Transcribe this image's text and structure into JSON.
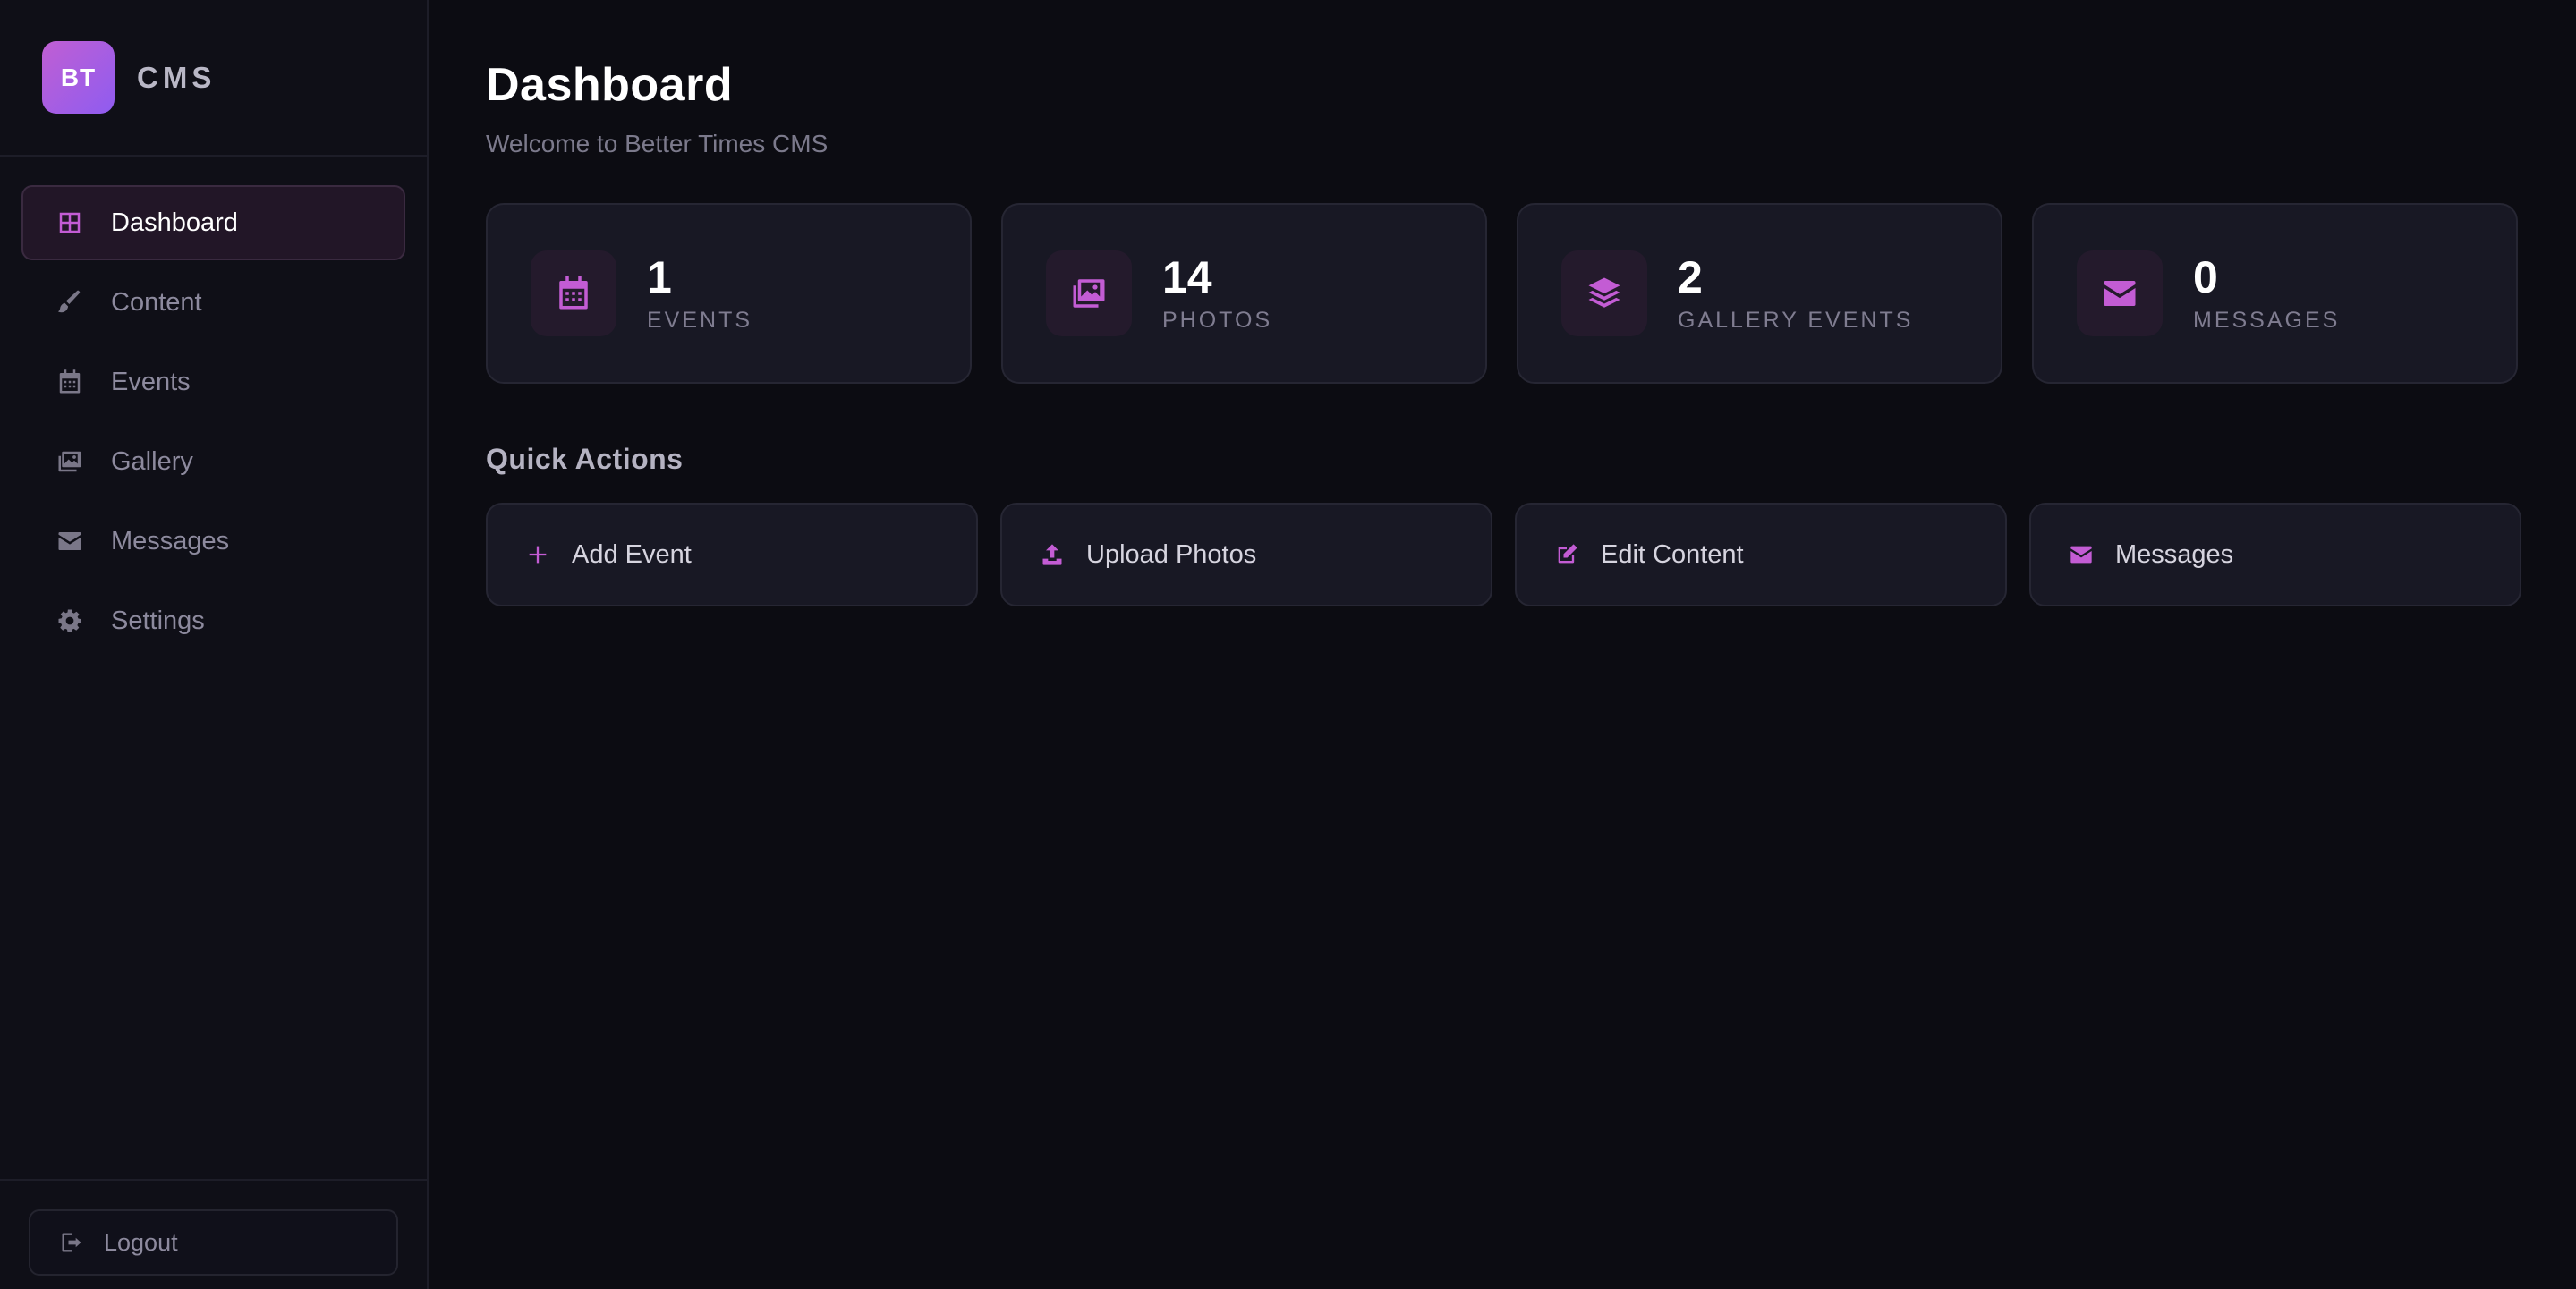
{
  "brand": {
    "logo_text": "BT",
    "name": "CMS"
  },
  "sidebar": {
    "items": [
      {
        "label": "Dashboard",
        "icon": "grid-icon",
        "active": true
      },
      {
        "label": "Content",
        "icon": "brush-icon",
        "active": false
      },
      {
        "label": "Events",
        "icon": "calendar-icon",
        "active": false
      },
      {
        "label": "Gallery",
        "icon": "images-icon",
        "active": false
      },
      {
        "label": "Messages",
        "icon": "envelope-icon",
        "active": false
      },
      {
        "label": "Settings",
        "icon": "gear-icon",
        "active": false
      }
    ],
    "logout_label": "Logout"
  },
  "header": {
    "title": "Dashboard",
    "subtitle": "Welcome to Better Times CMS"
  },
  "stats": [
    {
      "value": "1",
      "label": "EVENTS",
      "icon": "calendar-icon"
    },
    {
      "value": "14",
      "label": "PHOTOS",
      "icon": "images-icon"
    },
    {
      "value": "2",
      "label": "GALLERY EVENTS",
      "icon": "layers-icon"
    },
    {
      "value": "0",
      "label": "MESSAGES",
      "icon": "envelope-icon"
    }
  ],
  "quick_actions": {
    "title": "Quick Actions",
    "items": [
      {
        "label": "Add Event",
        "icon": "plus-icon"
      },
      {
        "label": "Upload Photos",
        "icon": "upload-icon"
      },
      {
        "label": "Edit Content",
        "icon": "edit-icon"
      },
      {
        "label": "Messages",
        "icon": "envelope-icon"
      }
    ]
  },
  "colors": {
    "accent": "#c35cd4",
    "background": "#0c0c12",
    "sidebar": "#0f0f17",
    "card": "#181824"
  }
}
